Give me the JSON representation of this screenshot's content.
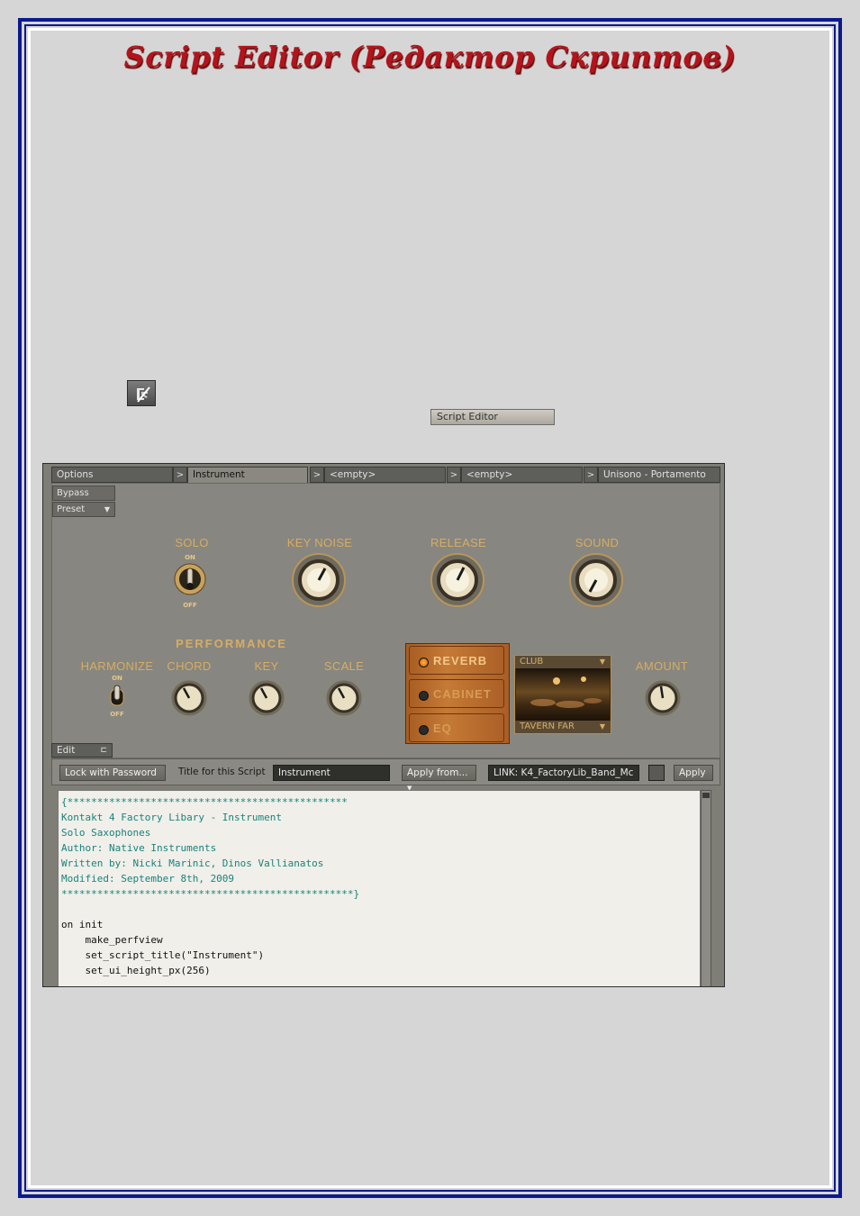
{
  "page": {
    "title": "Script Editor  (Редактор Скриптов)"
  },
  "toolbar_hint": {
    "script_editor_label": "Script Editor"
  },
  "kontakt": {
    "tabs": [
      {
        "label": "Options"
      },
      {
        "label": "Instrument"
      },
      {
        "label": "<empty>"
      },
      {
        "label": "<empty>"
      },
      {
        "label": "Unisono - Portamento"
      }
    ],
    "tab_arrow": ">",
    "bypass_label": "Bypass",
    "preset_label": "Preset",
    "controls_row1": [
      {
        "label": "SOLO"
      },
      {
        "label": "KEY NOISE"
      },
      {
        "label": "RELEASE"
      },
      {
        "label": "SOUND"
      }
    ],
    "switch_on": "ON",
    "switch_off": "OFF",
    "section_title": "PERFORMANCE",
    "controls_row2": [
      {
        "label": "HARMONIZE"
      },
      {
        "label": "CHORD"
      },
      {
        "label": "KEY"
      },
      {
        "label": "SCALE"
      },
      {
        "label": "AMOUNT"
      }
    ],
    "fx": [
      {
        "label": "REVERB",
        "state": "on"
      },
      {
        "label": "CABINET",
        "state": "off"
      },
      {
        "label": "EQ",
        "state": "off"
      }
    ],
    "room_top": "CLUB",
    "room_bottom": "TAVERN FAR",
    "edit_tab": "Edit",
    "lock_button": "Lock with Password",
    "title_label": "Title for this Script",
    "title_value": "Instrument",
    "apply_from": "Apply from...",
    "link_value": "LINK: K4_FactoryLib_Band_Mc",
    "apply_button": "Apply",
    "code_lines": [
      {
        "text": "{***********************************************",
        "kind": "comment"
      },
      {
        "text": "Kontakt 4 Factory Libary - Instrument",
        "kind": "comment"
      },
      {
        "text": "Solo Saxophones",
        "kind": "comment"
      },
      {
        "text": "Author: Native Instruments",
        "kind": "comment"
      },
      {
        "text": "Written by: Nicki Marinic, Dinos Vallianatos",
        "kind": "comment"
      },
      {
        "text": "Modified: September 8th, 2009",
        "kind": "comment"
      },
      {
        "text": "*************************************************}",
        "kind": "comment"
      },
      {
        "text": "",
        "kind": "code"
      },
      {
        "text": "on init",
        "kind": "code"
      },
      {
        "text": "    make_perfview",
        "kind": "code"
      },
      {
        "text": "    set_script_title(\"Instrument\")",
        "kind": "code"
      },
      {
        "text": "    set_ui_height_px(256)",
        "kind": "code"
      }
    ]
  }
}
